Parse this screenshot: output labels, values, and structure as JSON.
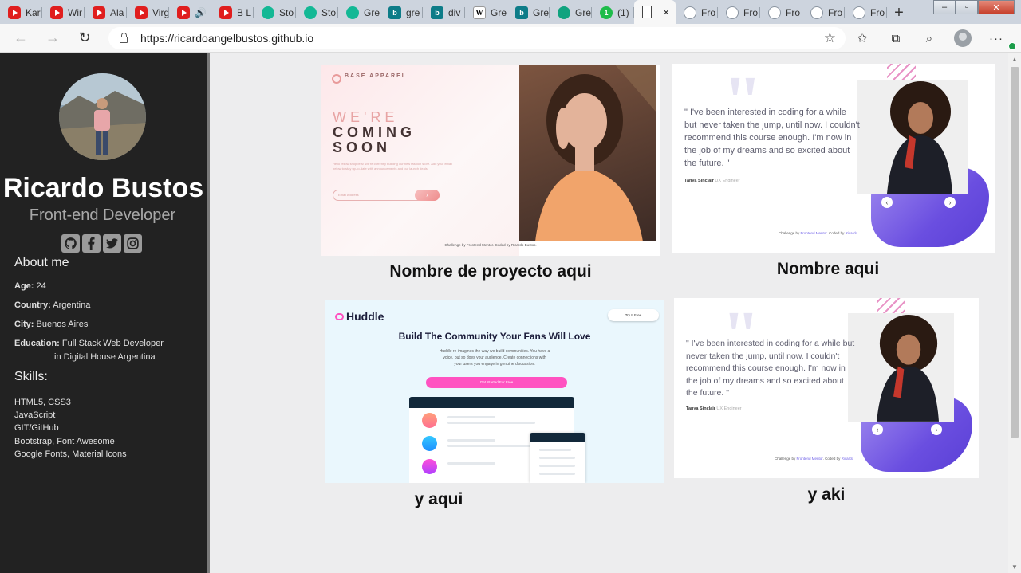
{
  "browser": {
    "tabs": [
      {
        "label": "Kar",
        "icon": "youtube-icon"
      },
      {
        "label": "Wir",
        "icon": "youtube-icon"
      },
      {
        "label": "Ala",
        "icon": "youtube-icon"
      },
      {
        "label": "Virg",
        "icon": "youtube-icon"
      },
      {
        "label": "🔊",
        "icon": "youtube-icon"
      },
      {
        "label": "B L",
        "icon": "youtube-icon"
      },
      {
        "label": "Sto",
        "icon": "freecodecamp-icon"
      },
      {
        "label": "Sto",
        "icon": "freecodecamp-icon"
      },
      {
        "label": "Gre",
        "icon": "freecodecamp-icon"
      },
      {
        "label": "gre",
        "icon": "bing-icon"
      },
      {
        "label": "div",
        "icon": "bing-icon"
      },
      {
        "label": "Gre",
        "icon": "wikipedia-icon"
      },
      {
        "label": "Gre",
        "icon": "bing-icon"
      },
      {
        "label": "Gre",
        "icon": "chatgpt-icon"
      },
      {
        "label": "(1)",
        "icon": "frontendmentor-icon"
      },
      {
        "label": "×",
        "icon": "document-icon",
        "active": true
      },
      {
        "label": "Fro",
        "icon": "github-icon"
      },
      {
        "label": "Fro",
        "icon": "github-icon"
      },
      {
        "label": "Fro",
        "icon": "github-icon"
      },
      {
        "label": "Fro",
        "icon": "github-icon"
      },
      {
        "label": "Fro",
        "icon": "github-icon"
      }
    ],
    "url": "https://ricardoangelbustos.github.io"
  },
  "profile": {
    "name": "Ricardo Bustos",
    "role": "Front-end Developer",
    "socials": [
      "github-icon",
      "facebook-icon",
      "twitter-icon",
      "instagram-icon"
    ],
    "about_heading": "About me",
    "about": [
      {
        "label": "Age:",
        "value": " 24"
      },
      {
        "label": "Country:",
        "value": " Argentina"
      },
      {
        "label": "City:",
        "value": " Buenos Aires"
      },
      {
        "label": "Education:",
        "value": " Full Stack Web Developer"
      }
    ],
    "education_line2": "in Digital House Argentina",
    "skills_heading": "Skills:",
    "skills": [
      "HTML5, CSS3",
      "JavaScript",
      "GIT/GitHub",
      "Bootstrap, Font Awesome",
      "Google Fonts, Material Icons"
    ]
  },
  "projects": [
    {
      "title": "Nombre de proyecto aqui",
      "preview": {
        "logo": "BASE APPAREL",
        "headline_light": "WE'RE",
        "headline_dark_1": "COMING",
        "headline_dark_2": "SOON",
        "paragraph": "Hello fellow shoppers! We're currently building our new fashion store. Add your email below to stay up-to-date with announcements and our launch deals.",
        "email_placeholder": "Email Address",
        "footer": "Challenge by Frontend Mentor. Coded by Ricardo Bustos."
      }
    },
    {
      "title": "Nombre aqui",
      "preview": {
        "quote": "\" I've been interested in coding for a while but never taken the jump, until now. I couldn't recommend this course enough. I'm now in the job of my dreams and so excited about the future. \"",
        "author": "Tanya Sinclair",
        "author_role": "UX Engineer",
        "footer_prefix": "Challenge by ",
        "footer_link": "Frontend Mentor",
        "footer_mid": ". Coded by ",
        "footer_link2": "Ricardo"
      }
    },
    {
      "title": "y aqui",
      "preview": {
        "logo": "Huddle",
        "try_label": "Try It Free",
        "headline": "Build The Community Your Fans Will Love",
        "sub": "Huddle re-imagines the way we build communities. You have a voice, but so does your audience. Create connections with your users you engage in genuine discussion.",
        "cta": "Get Started For Free"
      }
    },
    {
      "title": "y aki",
      "preview": {
        "quote": "\" I've been interested in coding for a while but never taken the jump, until now. I couldn't recommend this course enough. I'm now in the job of my dreams and so excited about the future. \"",
        "author": "Tanya Sinclair",
        "author_role": "UX Engineer",
        "footer_prefix": "Challenge by ",
        "footer_link": "Frontend Mentor",
        "footer_mid": ". Coded by ",
        "footer_link2": "Ricardo"
      }
    }
  ],
  "colors": {
    "sidebar_bg": "#222222",
    "page_bg": "#ededee",
    "accent_purple": "#6a4ee0",
    "accent_pink": "#ff52c1"
  }
}
